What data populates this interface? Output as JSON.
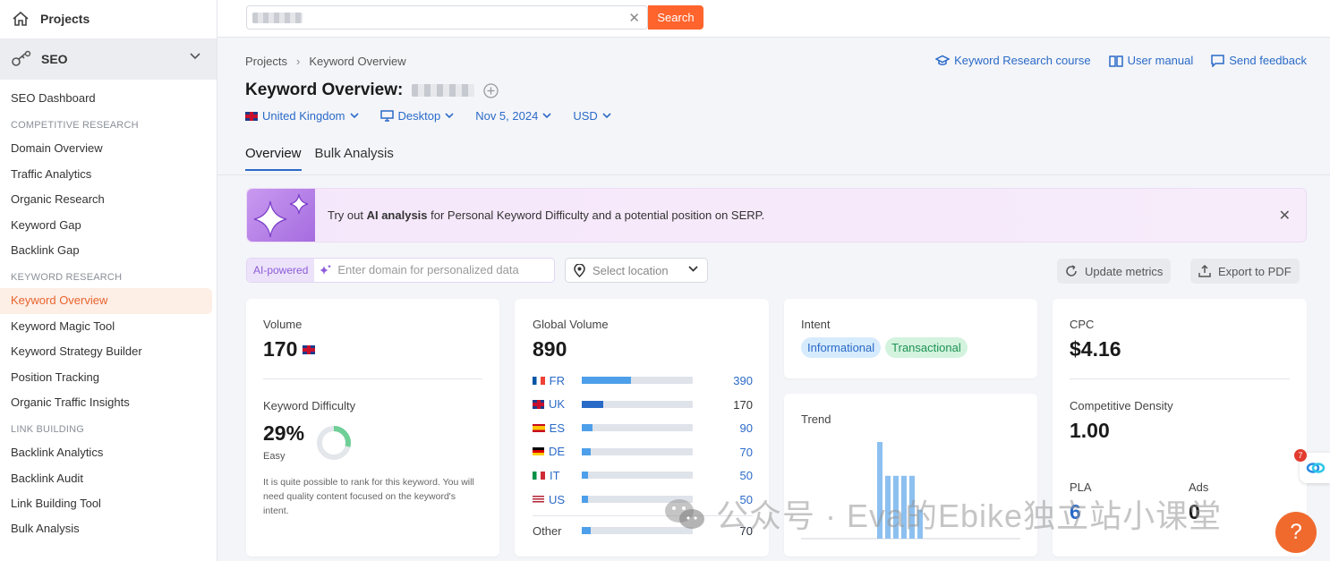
{
  "sidebar": {
    "projects": "Projects",
    "seo": "SEO",
    "dashboard": "SEO Dashboard",
    "sections": [
      {
        "title": "COMPETITIVE RESEARCH",
        "items": [
          "Domain Overview",
          "Traffic Analytics",
          "Organic Research",
          "Keyword Gap",
          "Backlink Gap"
        ]
      },
      {
        "title": "KEYWORD RESEARCH",
        "items": [
          "Keyword Overview",
          "Keyword Magic Tool",
          "Keyword Strategy Builder",
          "Position Tracking",
          "Organic Traffic Insights"
        ]
      },
      {
        "title": "LINK BUILDING",
        "items": [
          "Backlink Analytics",
          "Backlink Audit",
          "Link Building Tool",
          "Bulk Analysis"
        ]
      }
    ]
  },
  "search": {
    "button": "Search"
  },
  "breadcrumb": {
    "root": "Projects",
    "current": "Keyword Overview"
  },
  "links": {
    "course": "Keyword Research course",
    "manual": "User manual",
    "feedback": "Send feedback"
  },
  "title": "Keyword Overview:",
  "filters": {
    "country": "United Kingdom",
    "device": "Desktop",
    "date": "Nov 5, 2024",
    "currency": "USD"
  },
  "tabs": [
    "Overview",
    "Bulk Analysis"
  ],
  "banner": {
    "pre": "Try out ",
    "bold": "AI analysis",
    "post": " for Personal Keyword Difficulty and a potential position on SERP."
  },
  "tools": {
    "ai_tag": "AI-powered",
    "domain_placeholder": "Enter domain for personalized data",
    "location_placeholder": "Select location",
    "update": "Update metrics",
    "export": "Export to PDF"
  },
  "volume": {
    "label": "Volume",
    "value": "170"
  },
  "kd": {
    "label": "Keyword Difficulty",
    "value": "29%",
    "level": "Easy",
    "percent": 29,
    "desc": "It is quite possible to rank for this keyword. You will need quality content focused on the keyword's intent."
  },
  "global_volume": {
    "label": "Global Volume",
    "value": "890",
    "rows": [
      {
        "code": "FR",
        "value": "390",
        "fill": 0.44,
        "link": true
      },
      {
        "code": "UK",
        "value": "170",
        "fill": 0.19,
        "link": false
      },
      {
        "code": "ES",
        "value": "90",
        "fill": 0.1,
        "link": true
      },
      {
        "code": "DE",
        "value": "70",
        "fill": 0.08,
        "link": true
      },
      {
        "code": "IT",
        "value": "50",
        "fill": 0.06,
        "link": true
      },
      {
        "code": "US",
        "value": "50",
        "fill": 0.06,
        "link": true
      }
    ],
    "other": {
      "label": "Other",
      "value": "70",
      "fill": 0.08
    }
  },
  "intent": {
    "label": "Intent",
    "chips": [
      "Informational",
      "Transactional"
    ]
  },
  "trend": {
    "label": "Trend",
    "values": [
      0,
      0,
      0,
      0,
      0,
      0,
      0,
      0,
      1.0,
      0.65,
      0.65,
      0.65,
      0.65,
      0.3
    ]
  },
  "cpc": {
    "label": "CPC",
    "value": "$4.16"
  },
  "density": {
    "label": "Competitive Density",
    "value": "1.00"
  },
  "pla": {
    "label": "PLA",
    "value": "6"
  },
  "ads": {
    "label": "Ads",
    "value": "0"
  },
  "watermark": "公众号 · Eva的Ebike独立站小课堂",
  "help": "?",
  "badge": "7"
}
